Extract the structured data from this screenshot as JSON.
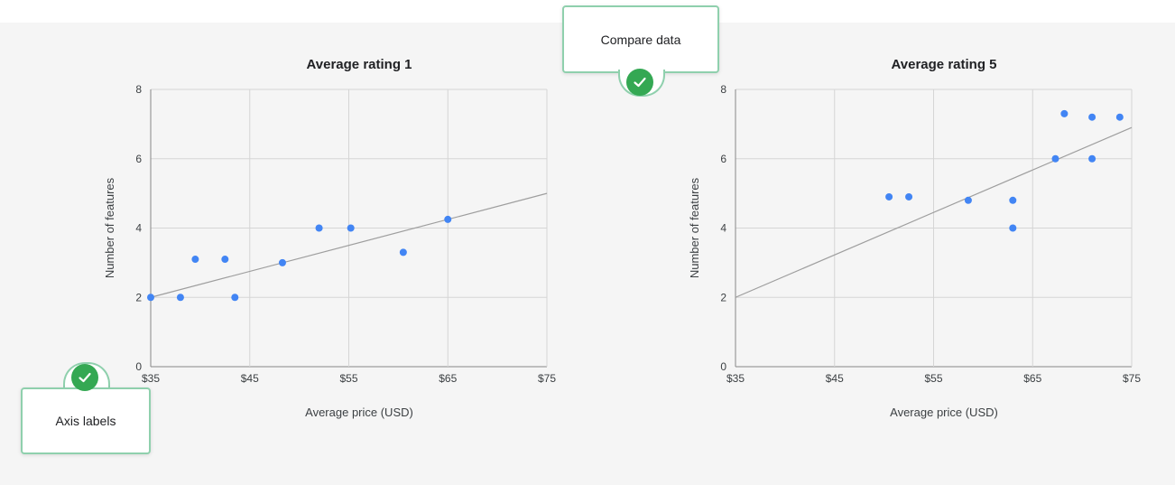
{
  "chart_data": [
    {
      "type": "scatter",
      "title": "Average rating 1",
      "xlabel": "Average price (USD)",
      "ylabel": "Number of features",
      "xlim": [
        35,
        75
      ],
      "ylim": [
        0,
        8
      ],
      "x_ticks": [
        "$35",
        "$45",
        "$55",
        "$65",
        "$75"
      ],
      "y_ticks": [
        "0",
        "2",
        "4",
        "6",
        "8"
      ],
      "grid": true,
      "trendline": [
        [
          35,
          2.0
        ],
        [
          75,
          5.0
        ]
      ],
      "points": [
        {
          "x": 35,
          "y": 2.0
        },
        {
          "x": 38,
          "y": 2.0
        },
        {
          "x": 39.5,
          "y": 3.1
        },
        {
          "x": 42.5,
          "y": 3.1
        },
        {
          "x": 43.5,
          "y": 2.0
        },
        {
          "x": 48.3,
          "y": 3.0
        },
        {
          "x": 52,
          "y": 4.0
        },
        {
          "x": 55.2,
          "y": 4.0
        },
        {
          "x": 60.5,
          "y": 3.3
        },
        {
          "x": 65,
          "y": 4.25
        }
      ]
    },
    {
      "type": "scatter",
      "title": "Average rating 5",
      "xlabel": "Average price (USD)",
      "ylabel": "Number of features",
      "xlim": [
        35,
        75
      ],
      "ylim": [
        0,
        8
      ],
      "x_ticks": [
        "$35",
        "$45",
        "$55",
        "$65",
        "$75"
      ],
      "y_ticks": [
        "0",
        "2",
        "4",
        "6",
        "8"
      ],
      "grid": true,
      "trendline": [
        [
          35,
          2.0
        ],
        [
          75,
          6.9
        ]
      ],
      "points": [
        {
          "x": 50.5,
          "y": 4.9
        },
        {
          "x": 52.5,
          "y": 4.9
        },
        {
          "x": 58.5,
          "y": 4.8
        },
        {
          "x": 63,
          "y": 4.8
        },
        {
          "x": 63,
          "y": 4.0
        },
        {
          "x": 67.3,
          "y": 6.0
        },
        {
          "x": 68.2,
          "y": 7.3
        },
        {
          "x": 71,
          "y": 7.2
        },
        {
          "x": 71,
          "y": 6.0
        },
        {
          "x": 73.8,
          "y": 7.2
        }
      ]
    }
  ],
  "callouts": {
    "compare": "Compare data",
    "axis": "Axis labels"
  },
  "colors": {
    "point": "#4285f4",
    "check": "#34a853",
    "callout_border": "#8fd0ad"
  }
}
